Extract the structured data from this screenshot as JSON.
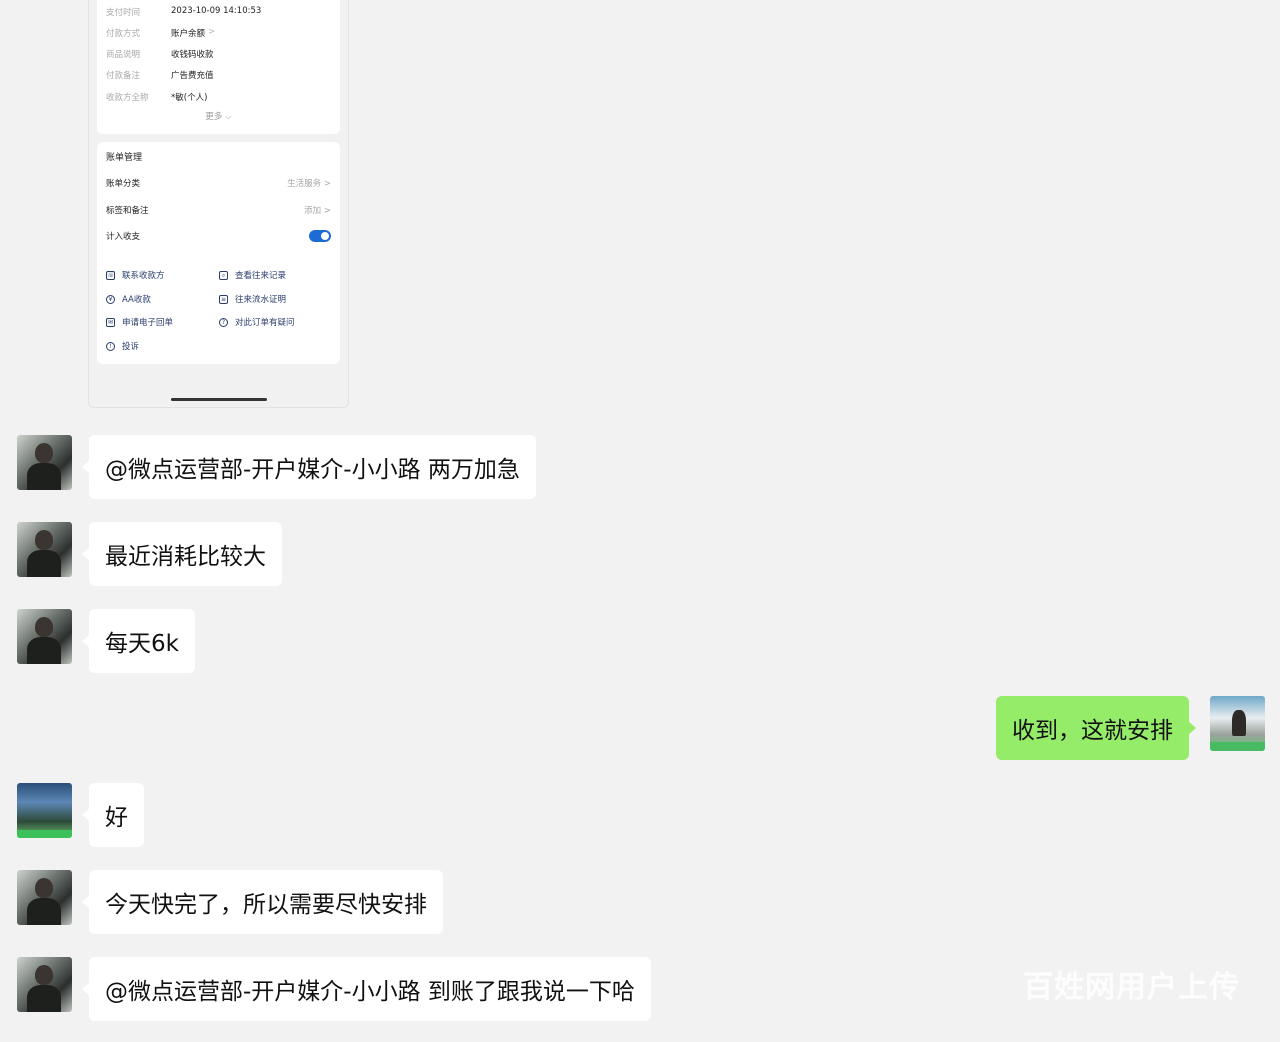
{
  "receipt": {
    "details": [
      {
        "key": "支付时间",
        "value": "2023-10-09 14:10:53",
        "chev": ""
      },
      {
        "key": "付款方式",
        "value": "账户余额",
        "chev": ">"
      },
      {
        "key": "商品说明",
        "value": "收钱码收款",
        "chev": ""
      },
      {
        "key": "付款备注",
        "value": "广告费充值",
        "chev": ""
      },
      {
        "key": "收款方全称",
        "value": "*敏(个人)",
        "chev": ""
      }
    ],
    "more_label": "更多 ⌵",
    "manage_title": "账单管理",
    "category_label": "账单分类",
    "category_value": "生活服务 >",
    "tags_label": "标签和备注",
    "tags_value": "添加 >",
    "count_label": "计入收支",
    "actions": {
      "contact": "联系收款方",
      "history": "查看往来记录",
      "aa": "AA收款",
      "proof": "往来流水证明",
      "ereceipt": "申请电子回单",
      "question": "对此订单有疑问",
      "complain": "投诉"
    }
  },
  "messages": [
    {
      "side": "in",
      "text": "@微点运营部-开户媒介-小小路 两万加急"
    },
    {
      "side": "in",
      "text": "最近消耗比较大"
    },
    {
      "side": "in",
      "text": "每天6k"
    },
    {
      "side": "out",
      "text": "收到，这就安排"
    },
    {
      "side": "in",
      "text": "好"
    },
    {
      "side": "in",
      "text": "今天快完了，所以需要尽快安排"
    },
    {
      "side": "in",
      "text": "@微点运营部-开户媒介-小小路 到账了跟我说一下哈"
    }
  ],
  "watermark": "百姓网用户上传"
}
